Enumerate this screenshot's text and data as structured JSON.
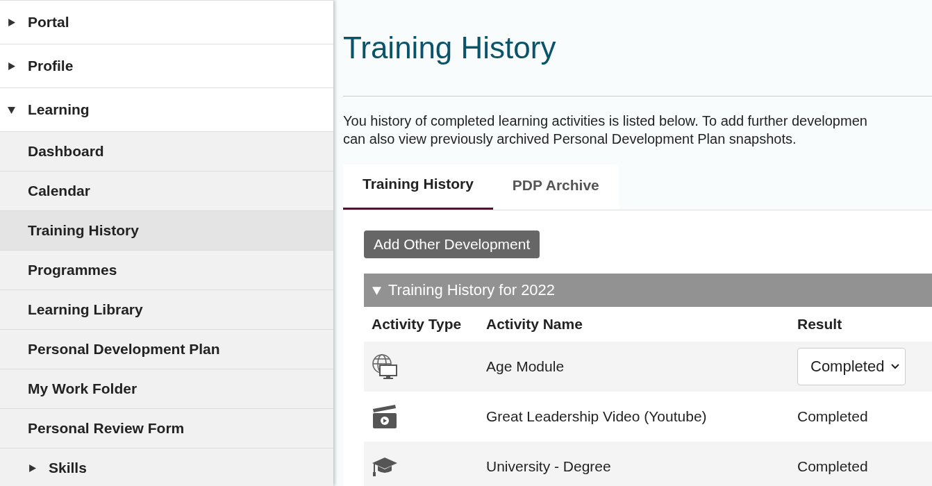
{
  "sidebar": {
    "items": [
      {
        "label": "Portal",
        "expanded": false,
        "selected": false
      },
      {
        "label": "Profile",
        "expanded": false,
        "selected": false
      },
      {
        "label": "Learning",
        "expanded": true,
        "selected": false,
        "children": [
          {
            "label": "Dashboard",
            "selected": false
          },
          {
            "label": "Calendar",
            "selected": false
          },
          {
            "label": "Training History",
            "selected": true
          },
          {
            "label": "Programmes",
            "selected": false
          },
          {
            "label": "Learning Library",
            "selected": false
          },
          {
            "label": "Personal Development Plan",
            "selected": false
          },
          {
            "label": "My Work Folder",
            "selected": false
          },
          {
            "label": "Personal Review Form",
            "selected": false
          },
          {
            "label": "Skills",
            "expanded": false,
            "selected": false
          }
        ]
      }
    ]
  },
  "page_title": "Training History",
  "intro": [
    "You history of completed learning activities is listed below. To add further developmen",
    "can also view previously archived Personal Development Plan snapshots."
  ],
  "tabs": [
    {
      "label": "Training History",
      "selected": true
    },
    {
      "label": "PDP Archive",
      "selected": false
    }
  ],
  "add_button": "Add Other Development",
  "group": {
    "title": "Training History for 2022",
    "expanded": true
  },
  "table": {
    "columns": [
      "Activity Type",
      "Activity Name",
      "Result"
    ],
    "rows": [
      {
        "kind": "e-learning",
        "name": "Age Module",
        "result": {
          "kind": "dropdown",
          "value": "Completed"
        }
      },
      {
        "kind": "video",
        "name": "Great Leadership Video (Youtube)",
        "result": {
          "kind": "text",
          "value": "Completed"
        }
      },
      {
        "kind": "degree",
        "name": "University - Degree",
        "result": {
          "kind": "text",
          "value": "Completed"
        }
      }
    ]
  }
}
